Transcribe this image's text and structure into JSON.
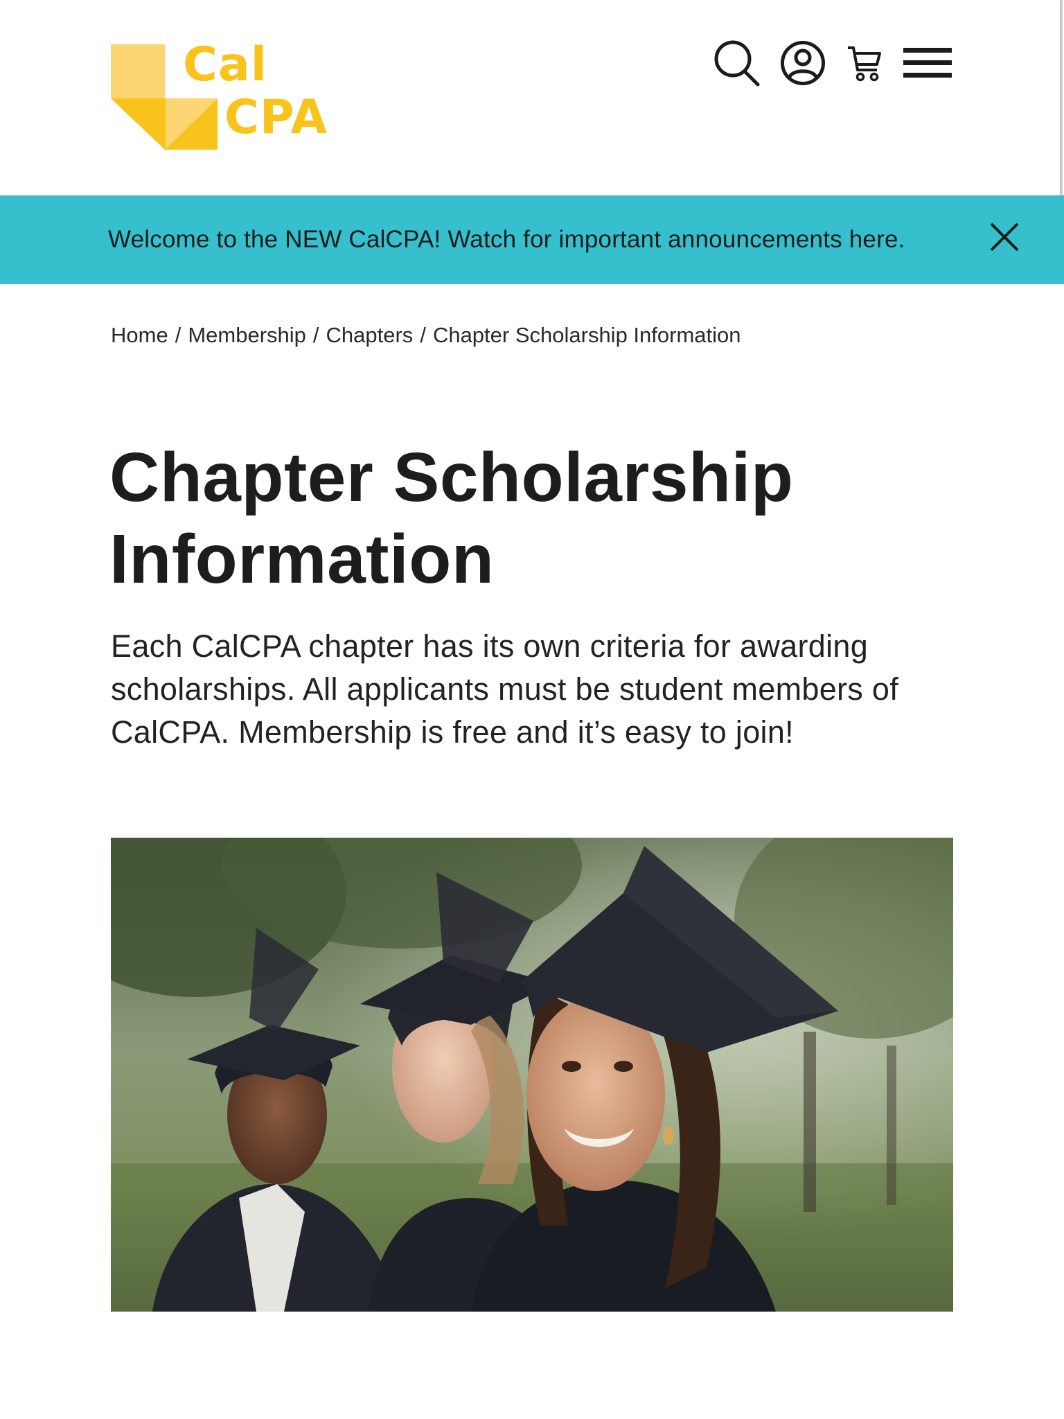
{
  "header": {
    "logo": {
      "line1": "Cal",
      "line2": "CPA",
      "icon": "calcpa-logo"
    },
    "icons": [
      "search-icon",
      "user-icon",
      "cart-icon",
      "menu-icon"
    ]
  },
  "announcement": {
    "text": "Welcome to the NEW CalCPA! Watch for important announcements here.",
    "close_icon": "close-icon",
    "background": "#36bfcd"
  },
  "breadcrumb": {
    "items": [
      "Home",
      "Membership",
      "Chapters",
      "Chapter Scholarship Information"
    ],
    "separator": "/"
  },
  "main": {
    "title": "Chapter Scholarship Information",
    "intro": "Each CalCPA chapter has its own criteria for awarding scholarships. All applicants must be student members of CalCPA. Membership is free and it’s easy to join!"
  },
  "colors": {
    "brand_yellow": "#f8c31b",
    "brand_yellow_light": "#fcd97a",
    "announcement": "#36bfcd",
    "text": "#1f1c1c"
  }
}
